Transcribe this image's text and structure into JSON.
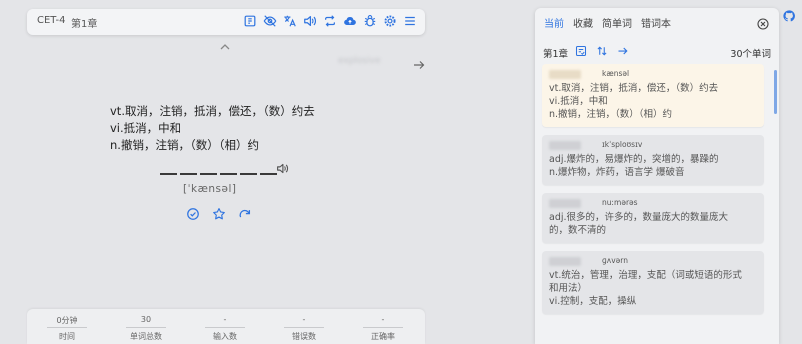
{
  "topbar": {
    "dict": "CET-4",
    "chapter": "第1章",
    "icons": [
      "dictation-icon",
      "eye-off-icon",
      "translate-icon",
      "speaker-icon",
      "repeat-icon",
      "cloud-upload-icon",
      "bug-icon",
      "settings-icon",
      "menu-icon"
    ]
  },
  "word": {
    "definitions": [
      "vt.取消，注销，抵消，偿还，（数）约去",
      "vi.抵消，中和",
      "n.撤销，注销，（数）（相）约"
    ],
    "phonetic": "[ˈkænsəl]",
    "letters": 6
  },
  "stats": [
    {
      "value": "0分钟",
      "label": "时间"
    },
    {
      "value": "30",
      "label": "单词总数"
    },
    {
      "value": "-",
      "label": "输入数"
    },
    {
      "value": "-",
      "label": "错误数"
    },
    {
      "value": "-",
      "label": "正确率"
    }
  ],
  "panel": {
    "tabs": [
      "当前",
      "收藏",
      "简单词",
      "错词本"
    ],
    "chapter": "第1章",
    "count": "30个单词",
    "cards": [
      {
        "phonetic": "kænsəl",
        "defs": [
          "vt.取消，注销，抵消，偿还，（数）约去",
          "vi.抵消，中和",
          "n.撤销，注销，（数）（相）约"
        ],
        "active": true
      },
      {
        "phonetic": "ɪkˈsploʊsɪv",
        "defs": [
          "adj.爆炸的，易爆炸的，突增的，暴躁的",
          "n.爆炸物，炸药，语言学 爆破音"
        ],
        "active": false
      },
      {
        "phonetic": "nuːmərəs",
        "defs": [
          "adj.很多的，许多的，数量庞大的数量庞大",
          "的，数不清的"
        ],
        "active": false
      },
      {
        "phonetic": "ɡʌvərn",
        "defs": [
          "vt.统治，管理，治理，支配（词或短语的形式",
          "和用法）",
          "vi.控制，支配，操纵"
        ],
        "active": false
      }
    ]
  },
  "colors": {
    "accent": "#2f74e0",
    "active_card": "#fcf5e8"
  }
}
